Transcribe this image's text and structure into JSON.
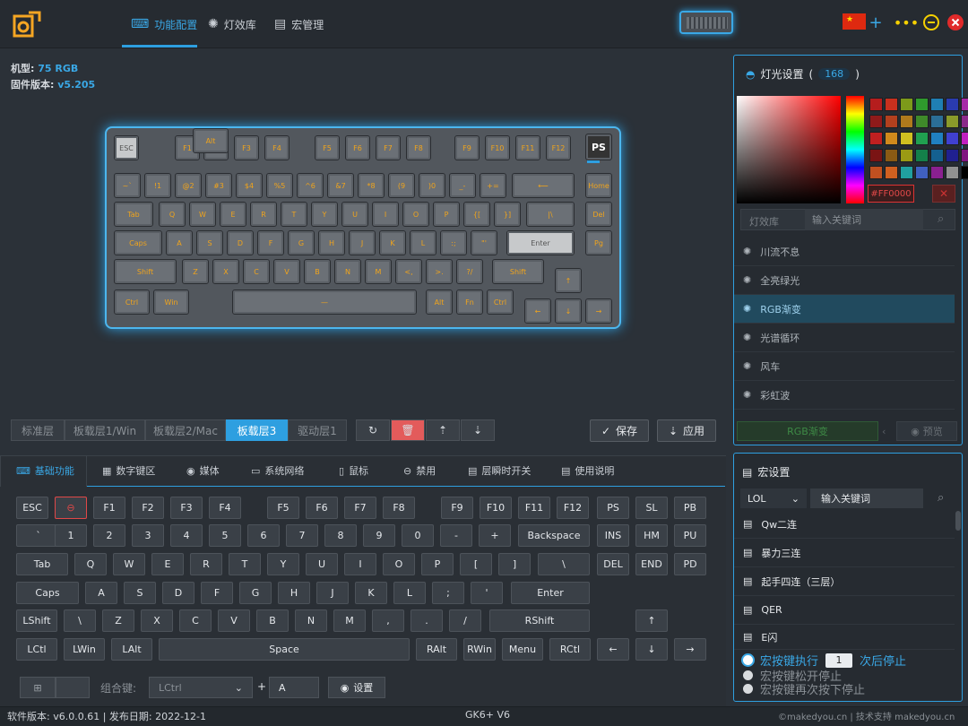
{
  "nav": {
    "tabs": [
      {
        "label": "功能配置",
        "icon": "keyboard-icon"
      },
      {
        "label": "灯效库",
        "icon": "light-bulb-icon"
      },
      {
        "label": "宏管理",
        "icon": "document-icon"
      }
    ]
  },
  "device": {
    "model_label": "机型:",
    "model_value": "75 RGB",
    "firmware_label": "固件版本:",
    "firmware_value": "v5.205"
  },
  "keyboard_legends": {
    "fn_row": [
      "ESC",
      "F1",
      "F2",
      "F3",
      "F4",
      "F5",
      "F6",
      "F7",
      "F8",
      "F9",
      "F10",
      "F11",
      "F12"
    ],
    "ps_label": "PS",
    "num_row": [
      "~`",
      "!1",
      "@2",
      "#3",
      "$4",
      "%5",
      "^6",
      "&7",
      "*8",
      "(9",
      ")0",
      "_-",
      "+="
    ],
    "tab_row": [
      "Tab",
      "Q",
      "W",
      "E",
      "R",
      "T",
      "Y",
      "U",
      "I",
      "O",
      "P",
      "{[",
      "}]",
      "|\\"
    ],
    "caps_row": [
      "Caps",
      "A",
      "S",
      "D",
      "F",
      "G",
      "H",
      "J",
      "K",
      "L",
      ":;",
      "\"'",
      "Enter"
    ],
    "shift_row": [
      "Shift",
      "Z",
      "X",
      "C",
      "V",
      "B",
      "N",
      "M",
      "<,",
      ">.",
      "?/",
      "Shift"
    ],
    "ctrl_row": [
      "Ctrl",
      "Win",
      "Alt",
      "Alt",
      "Fn",
      "Ctrl"
    ],
    "nav_col": [
      "Home",
      "Del",
      "Pg"
    ]
  },
  "layers": {
    "items": [
      "标准层",
      "板载层1/Win",
      "板载层2/Mac",
      "板载层3",
      "驱动层1"
    ],
    "active_index": 3,
    "save_label": "保存",
    "apply_label": "应用"
  },
  "func_tabs": [
    {
      "label": "基础功能",
      "icon": "keyboard-icon"
    },
    {
      "label": "数字键区",
      "icon": "numpad-icon"
    },
    {
      "label": "媒体",
      "icon": "play-icon"
    },
    {
      "label": "系统网络",
      "icon": "monitor-icon"
    },
    {
      "label": "鼠标",
      "icon": "mouse-icon"
    },
    {
      "label": "禁用",
      "icon": "disable-icon"
    },
    {
      "label": "层瞬时开关",
      "icon": "layer-icon"
    },
    {
      "label": "使用说明",
      "icon": "document-icon"
    }
  ],
  "vkeys": {
    "row1": [
      "ESC",
      "⊖",
      "F1",
      "F2",
      "F3",
      "F4",
      "F5",
      "F6",
      "F7",
      "F8",
      "F9",
      "F10",
      "F11",
      "F12",
      "PS",
      "SL",
      "PB"
    ],
    "row2": [
      "`",
      "1",
      "2",
      "3",
      "4",
      "5",
      "6",
      "7",
      "8",
      "9",
      "0",
      "-",
      "+",
      "Backspace",
      "INS",
      "HM",
      "PU"
    ],
    "row3": [
      "Tab",
      "Q",
      "W",
      "E",
      "R",
      "T",
      "Y",
      "U",
      "I",
      "O",
      "P",
      "[",
      "]",
      "\\",
      "DEL",
      "END",
      "PD"
    ],
    "row4": [
      "Caps",
      "A",
      "S",
      "D",
      "F",
      "G",
      "H",
      "J",
      "K",
      "L",
      ";",
      "'",
      "Enter"
    ],
    "row5": [
      "LShift",
      "\\",
      "Z",
      "X",
      "C",
      "V",
      "B",
      "N",
      "M",
      ",",
      ".",
      "/",
      "RShift",
      "↑"
    ],
    "row6": [
      "LCtl",
      "LWin",
      "LAlt",
      "Space",
      "RAlt",
      "RWin",
      "Menu",
      "RCtl",
      "←",
      "↓",
      "→"
    ]
  },
  "combo": {
    "label": "组合键:",
    "select_value": "LCtrl",
    "plus": "+",
    "key_value": "A",
    "settings_label": "设置"
  },
  "light_panel": {
    "title": "灯光设置",
    "count": "168",
    "hex_value": "#FF0000",
    "library_label": "灯效库",
    "search_placeholder": "输入关键词",
    "effects": [
      "川流不息",
      "全亮绿光",
      "RGB渐变",
      "光谱循环",
      "风车",
      "彩虹波"
    ],
    "active_index": 2,
    "current_effect": "RGB渐变",
    "preview_label": "预览"
  },
  "swatch_colors": [
    "#b51d1d",
    "#c8301e",
    "#7d9a1a",
    "#2f9a2d",
    "#1f7fb3",
    "#2a3bb0",
    "#a72aa8",
    "#8f1a1a",
    "#b3401e",
    "#b07a1c",
    "#3f8a2a",
    "#2b6e96",
    "#8a9a2a",
    "#8a2a8a",
    "#c02020",
    "#d08a1c",
    "#d0c020",
    "#20a050",
    "#2080c0",
    "#4040d0",
    "#c020c0",
    "#7a1414",
    "#8a5a14",
    "#9a9a14",
    "#14804a",
    "#146090",
    "#202090",
    "#801480",
    "#c05020",
    "#d06020",
    "#20a0a0",
    "#4060c0",
    "#8a2090",
    "#909090",
    "#000000"
  ],
  "macro_panel": {
    "title": "宏设置",
    "game_select": "LOL",
    "search_placeholder": "输入关键词",
    "macros": [
      "Qw二连",
      "暴力三连",
      "起手四连（三层）",
      "QER",
      "E闪"
    ],
    "option1_prefix": "宏按键执行",
    "option1_count": "1",
    "option1_suffix": "次后停止",
    "option2": "宏按键松开停止",
    "option3": "宏按键再次按下停止"
  },
  "status": {
    "left": "软件版本: v6.0.0.61 | 发布日期: 2022-12-1",
    "center": "GK6+ V6",
    "right": "©makedyou.cn | 技术支持 makedyou.cn"
  },
  "colors": {
    "accent": "#2e9fe0",
    "key_legend": "#f0a41c",
    "delete_red": "#e35b5b"
  }
}
